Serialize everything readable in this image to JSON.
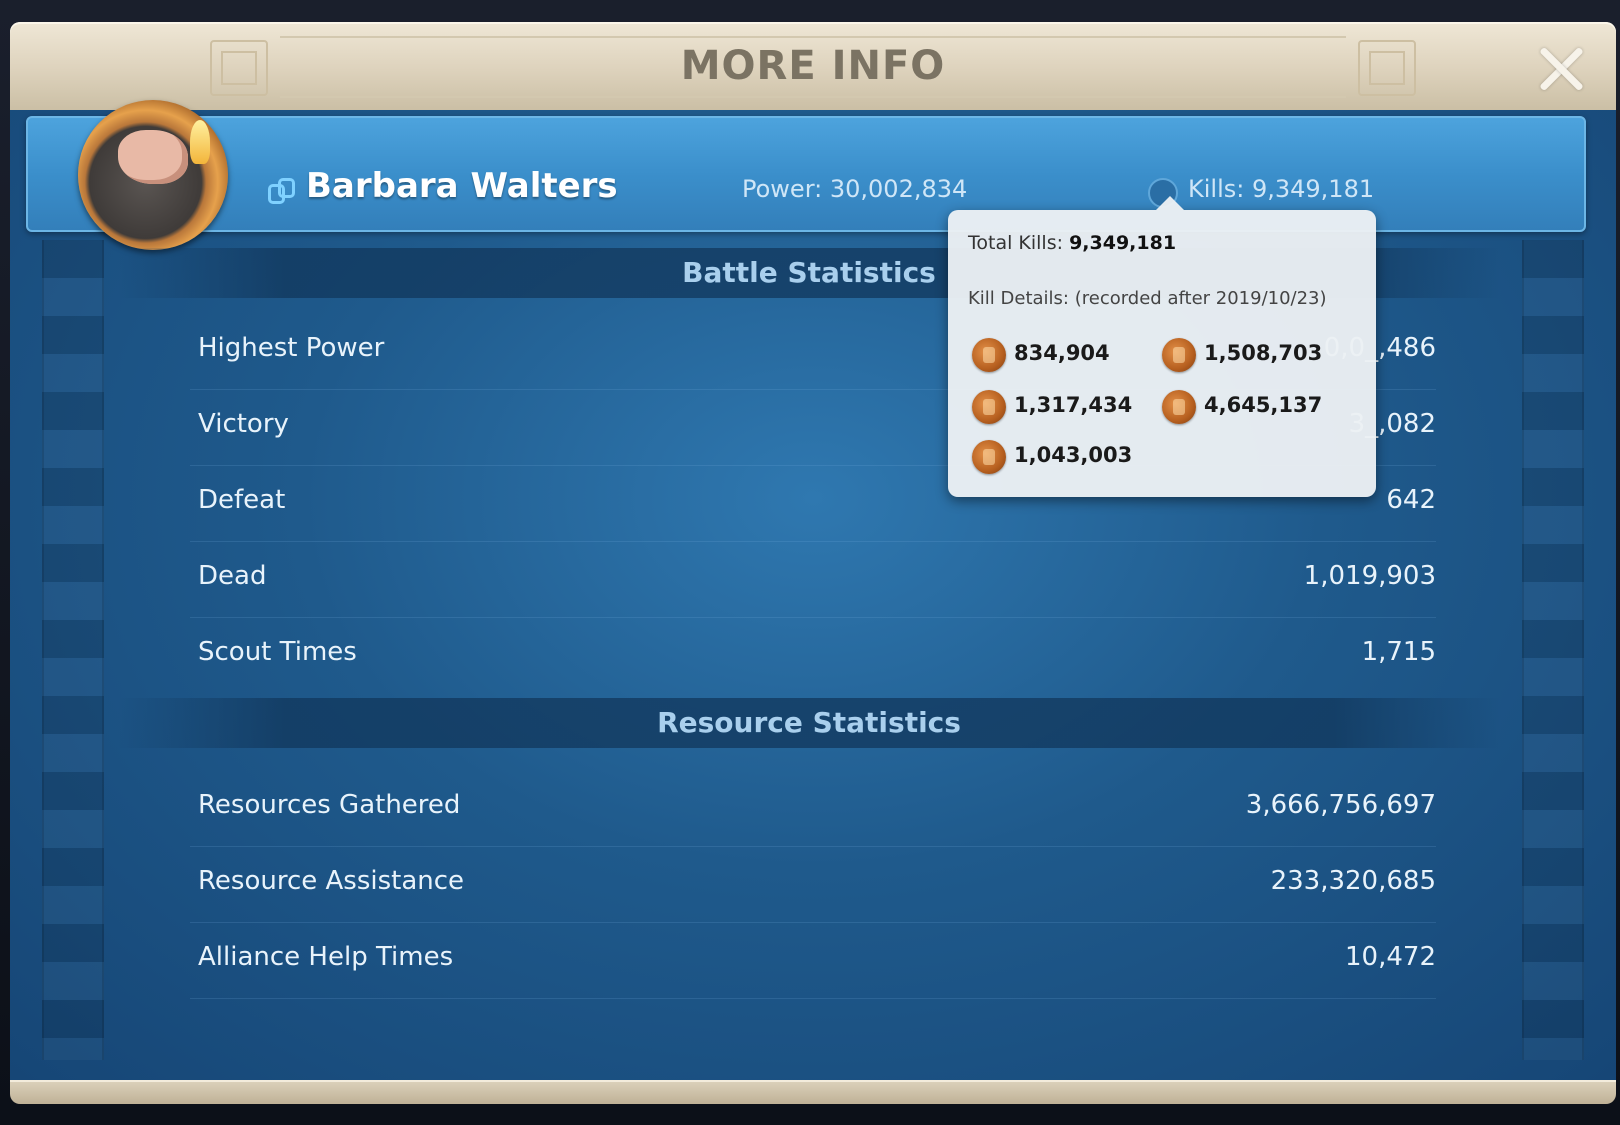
{
  "dialog": {
    "title": "MORE INFO"
  },
  "player": {
    "name": "Barbara Walters",
    "power": "Power: 30,002,834",
    "kills": "Kills: 9,349,181"
  },
  "battle": {
    "title": "Battle Statistics",
    "rows": [
      {
        "label": "Highest Power",
        "value": "0,0_,486"
      },
      {
        "label": "Victory",
        "value": "3_,082"
      },
      {
        "label": "Defeat",
        "value": "642"
      },
      {
        "label": "Dead",
        "value": "1,019,903"
      },
      {
        "label": "Scout Times",
        "value": "1,715"
      }
    ]
  },
  "resource": {
    "title": "Resource Statistics",
    "rows": [
      {
        "label": "Resources Gathered",
        "value": "3,666,756,697"
      },
      {
        "label": "Resource Assistance",
        "value": "233,320,685"
      },
      {
        "label": "Alliance Help Times",
        "value": "10,472"
      }
    ]
  },
  "tooltip": {
    "total_prefix": "Total Kills: ",
    "total_value": "9,349,181",
    "details": "Kill Details: (recorded after 2019/10/23)",
    "items": [
      "834,904",
      "1,508,703",
      "1,317,434",
      "4,645,137",
      "1,043,003"
    ]
  },
  "colors": {
    "panel_blue": "#1f5a8c",
    "banner_blue": "#3b8fcb",
    "title_parchment": "#ddd2bc"
  },
  "icons": {
    "close": "close-icon",
    "link": "link-icon",
    "kills": "kills-info-icon",
    "medal": "kill-medal-icon"
  }
}
